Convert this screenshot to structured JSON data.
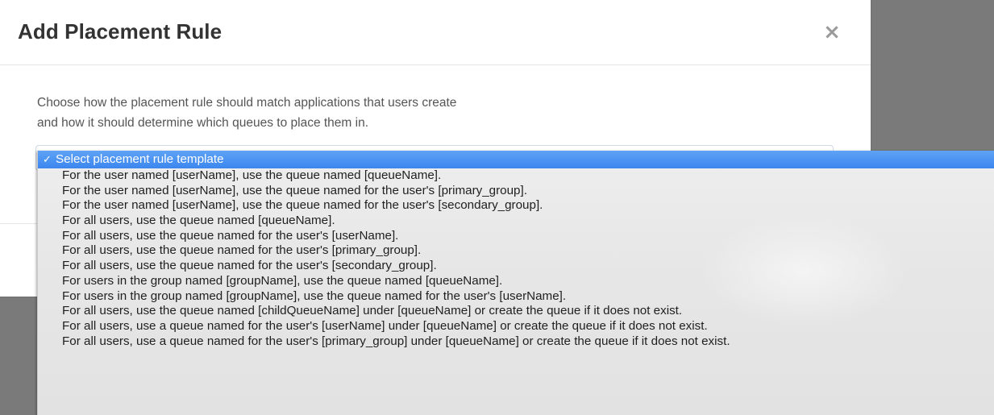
{
  "modal": {
    "title": "Add Placement Rule",
    "close_glyph": "×",
    "description_line1": "Choose how the placement rule should match applications that users create",
    "description_line2": "and how it should determine which queues to place them in."
  },
  "dropdown": {
    "check_glyph": "✓",
    "selected_label": "Select placement rule template",
    "options": [
      "For the user named [userName], use the queue named [queueName].",
      "For the user named [userName], use the queue named for the user's [primary_group].",
      "For the user named [userName], use the queue named for the user's [secondary_group].",
      "For all users, use the queue named [queueName].",
      "For all users, use the queue named for the user's [userName].",
      "For all users, use the queue named for the user's [primary_group].",
      "For all users, use the queue named for the user's [secondary_group].",
      "For users in the group named [groupName], use the queue named [queueName].",
      "For users in the group named [groupName], use the queue named for the user's [userName].",
      "For all users, use the queue named [childQueueName] under [queueName] or create the queue if it does not exist.",
      "For all users, use a queue named for the user's [userName] under [queueName] or create the queue if it does not exist.",
      "For all users, use a queue named for the user's [primary_group] under [queueName] or create the queue if it does not exist."
    ]
  },
  "colors": {
    "backdrop": "#7a7a7a",
    "selected_highlight": "#3c86ef",
    "title_text": "#333333"
  }
}
